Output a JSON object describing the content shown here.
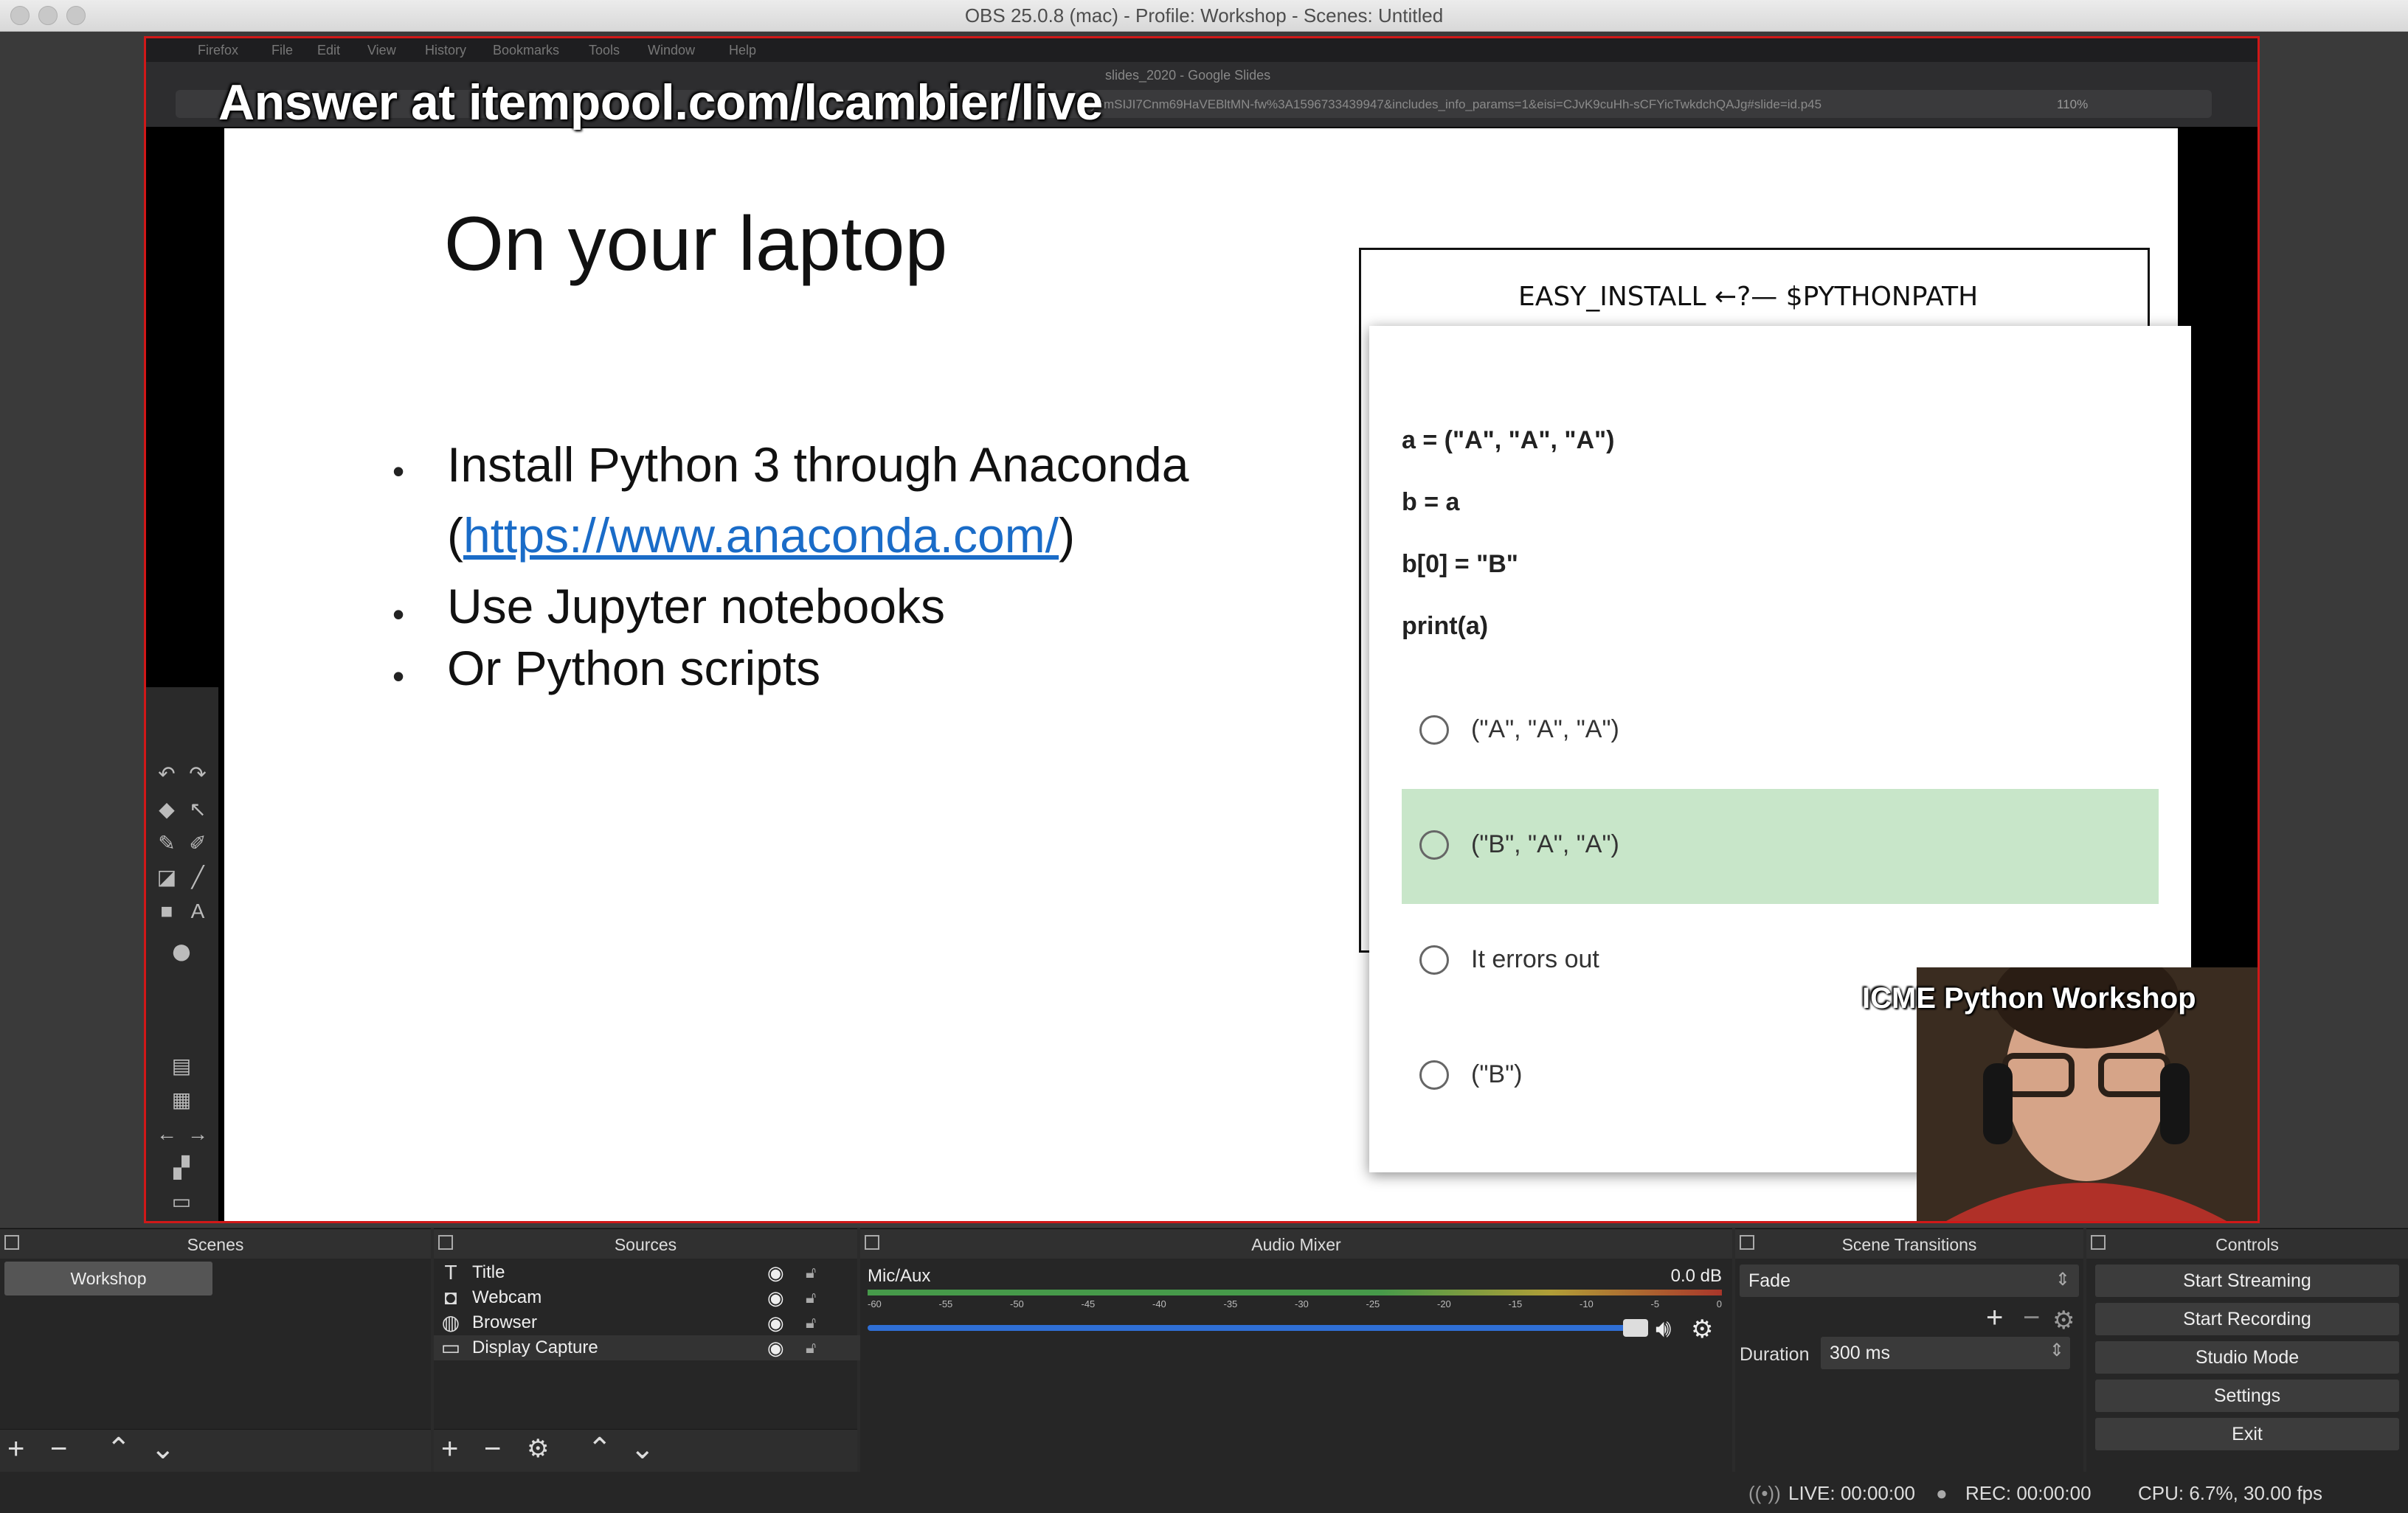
{
  "window": {
    "title": "OBS 25.0.8 (mac) - Profile: Workshop - Scenes: Untitled"
  },
  "browser": {
    "menu": [
      "Firefox",
      "File",
      "Edit",
      "View",
      "History",
      "Bookmarks",
      "Tools",
      "Window",
      "Help"
    ],
    "tab_title": "slides_2020 - Google Slides",
    "url_fragment": "y6mSIJI7Cnm69HaVEBltMN-fw%3A1596733439947&includes_info_params=1&eisi=CJvK9cuHh-sCFYicTwkdchQAJg#slide=id.p45",
    "zoom": "110%"
  },
  "overlay": {
    "answer": "Answer at itempool.com/lcambier/live",
    "webcam_label": "ICME Python Workshop"
  },
  "slide": {
    "title": "On your laptop",
    "bullets": [
      "Install Python 3 through Anaconda",
      "Use Jupyter notebooks",
      "Or Python scripts"
    ],
    "link_prefix": "(",
    "link": "https://www.anaconda.com/",
    "link_suffix": ")",
    "comic_text": "EASY_INSTALL ←?— $PYTHONPATH"
  },
  "quiz": {
    "code": [
      "a = (\"A\", \"A\", \"A\")",
      "b = a",
      "b[0] = \"B\"",
      "print(a)"
    ],
    "options": [
      "(\"A\", \"A\", \"A\")",
      "(\"B\", \"A\", \"A\")",
      "It errors out",
      "(\"B\")"
    ],
    "selected_index": 1
  },
  "scenes": {
    "header": "Scenes",
    "items": [
      "Workshop"
    ]
  },
  "sources": {
    "header": "Sources",
    "items": [
      "Title",
      "Webcam",
      "Browser",
      "Display Capture"
    ]
  },
  "audio": {
    "header": "Audio Mixer",
    "channel": "Mic/Aux",
    "level": "0.0 dB",
    "ticks": [
      "-60",
      "-55",
      "-50",
      "-45",
      "-40",
      "-35",
      "-30",
      "-25",
      "-20",
      "-15",
      "-10",
      "-5",
      "0"
    ]
  },
  "transitions": {
    "header": "Scene Transitions",
    "type": "Fade",
    "duration_label": "Duration",
    "duration": "300 ms"
  },
  "controls": {
    "header": "Controls",
    "buttons": [
      "Start Streaming",
      "Start Recording",
      "Studio Mode",
      "Settings",
      "Exit"
    ]
  },
  "status": {
    "live": "LIVE: 00:00:00",
    "rec": "REC: 00:00:00",
    "cpu": "CPU: 6.7%, 30.00 fps"
  },
  "colors": {
    "accent_border": "#d01818",
    "selected_option": "#c8e6c9",
    "link": "#1a6cc8",
    "meter_green": "#4caf50"
  }
}
